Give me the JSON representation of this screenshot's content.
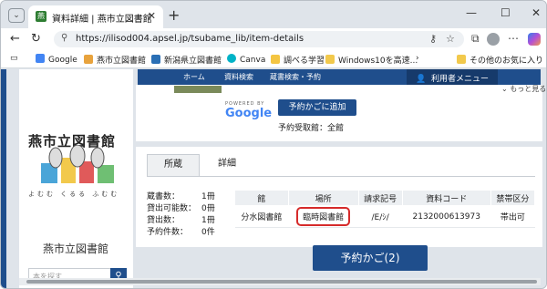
{
  "browser": {
    "tab_title": "資料詳細 | 燕市立図書館",
    "url": "https://ilisod004.apsel.jp/tsubame_lib/item-details",
    "bookmarks": [
      "Google",
      "燕市立図書館",
      "新潟県立図書館",
      "Canva",
      "調べる学習",
      "Windows10を高速..."
    ],
    "other_favorites": "その他のお気に入り"
  },
  "site": {
    "logo_title": "燕市立図書館",
    "logo_sub": "よむむ くるる ふむむ",
    "library_name": "燕市立図書館",
    "search_placeholder": "本を探す..."
  },
  "nav": {
    "home": "ホーム",
    "search": "資料検索",
    "reserve": "蔵書検索・予約",
    "user_menu": "利用者メニュー",
    "show_more": "もっと見る"
  },
  "top_card": {
    "powered_by": "POWERED BY",
    "google": "Google",
    "add_cart": "予約かごに追加",
    "pickup": "予約受取館：全館"
  },
  "tabs": {
    "owned": "所蔵",
    "detail": "詳細"
  },
  "stats": [
    {
      "label": "蔵書数：",
      "value": "1冊"
    },
    {
      "label": "貸出可能数：",
      "value": "0冊"
    },
    {
      "label": "貸出数：",
      "value": "1冊"
    },
    {
      "label": "予約件数：",
      "value": "0件"
    }
  ],
  "holdings": {
    "headers": [
      "館",
      "場所",
      "請求記号",
      "資料コード",
      "禁帯区分"
    ],
    "rows": [
      [
        "分水図書館",
        "臨時図書館",
        "/E/ｼ/",
        "2132000613973",
        "帯出可"
      ]
    ]
  },
  "cart_button": "予約かご(2)"
}
